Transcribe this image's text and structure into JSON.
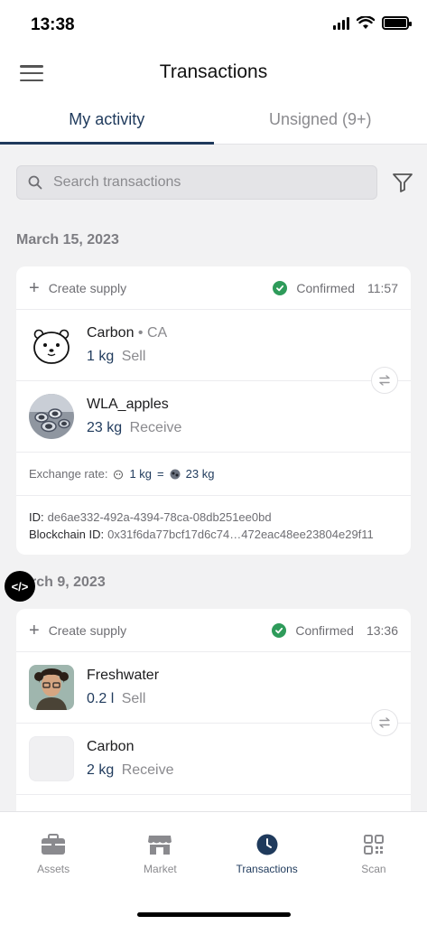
{
  "status": {
    "time": "13:38"
  },
  "header": {
    "title": "Transactions"
  },
  "tabs": [
    {
      "label": "My activity",
      "active": true
    },
    {
      "label": "Unsigned (9+)",
      "active": false
    }
  ],
  "search": {
    "placeholder": "Search transactions"
  },
  "groups": [
    {
      "date": "March 15, 2023",
      "type_label": "Create supply",
      "status": "Confirmed",
      "time": "11:57",
      "assets": [
        {
          "name": "Carbon",
          "sub": "CA",
          "qty": "1 kg",
          "action": "Sell"
        },
        {
          "name": "WLA_apples",
          "qty": "23 kg",
          "action": "Receive"
        }
      ],
      "exchange_label": "Exchange rate:",
      "exchange_from": "1 kg",
      "exchange_eq": "=",
      "exchange_to": "23 kg",
      "id_label": "ID:",
      "id_value": "de6ae332-492a-4394-78ca-08db251ee0bd",
      "chain_label": "Blockchain ID:",
      "chain_value": "0x31f6da77bcf17d6c74…472eac48ee23804e29f11"
    },
    {
      "date": "rch 9, 2023",
      "type_label": "Create supply",
      "status": "Confirmed",
      "time": "13:36",
      "assets": [
        {
          "name": "Freshwater",
          "qty": "0.2 l",
          "action": "Sell"
        },
        {
          "name": "Carbon",
          "qty": "2 kg",
          "action": "Receive"
        }
      ]
    }
  ],
  "dev_badge": "</>",
  "tabbar": [
    {
      "label": "Assets",
      "icon": "briefcase-icon",
      "active": false
    },
    {
      "label": "Market",
      "icon": "store-icon",
      "active": false
    },
    {
      "label": "Transactions",
      "icon": "clock-icon",
      "active": true
    },
    {
      "label": "Scan",
      "icon": "qr-icon",
      "active": false
    }
  ],
  "colors": {
    "accent": "#1f3a5c",
    "confirmed": "#2e9b5a",
    "background": "#f2f2f3"
  }
}
